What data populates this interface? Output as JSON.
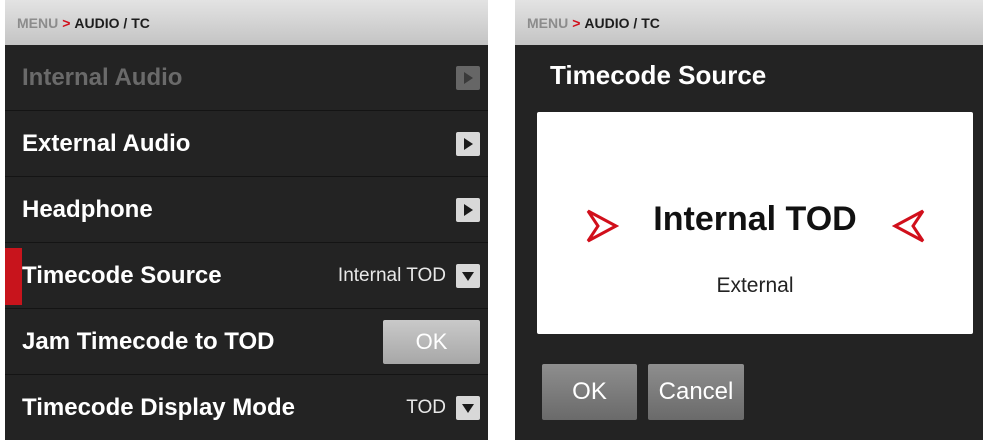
{
  "left_panel": {
    "breadcrumb": {
      "menu": "MENU",
      "separator": ">",
      "page": "AUDIO / TC"
    },
    "rows": [
      {
        "label": "Internal Audio",
        "type": "submenu",
        "disabled": true
      },
      {
        "label": "External Audio",
        "type": "submenu"
      },
      {
        "label": "Headphone",
        "type": "submenu"
      },
      {
        "label": "Timecode Source",
        "type": "dropdown",
        "value": "Internal TOD",
        "selected": true
      },
      {
        "label": "Jam Timecode to TOD",
        "type": "button",
        "button_label": "OK"
      },
      {
        "label": "Timecode Display Mode",
        "type": "dropdown",
        "value": "TOD"
      }
    ]
  },
  "right_panel": {
    "breadcrumb": {
      "menu": "MENU",
      "separator": ">",
      "page": "AUDIO / TC"
    },
    "title": "Timecode Source",
    "picker": {
      "selected": "Internal TOD",
      "other": "External"
    },
    "buttons": {
      "ok": "OK",
      "cancel": "Cancel"
    }
  },
  "colors": {
    "accent": "#d10f1b",
    "panel_bg": "#232323",
    "header_bg": "#d4d4d4"
  }
}
